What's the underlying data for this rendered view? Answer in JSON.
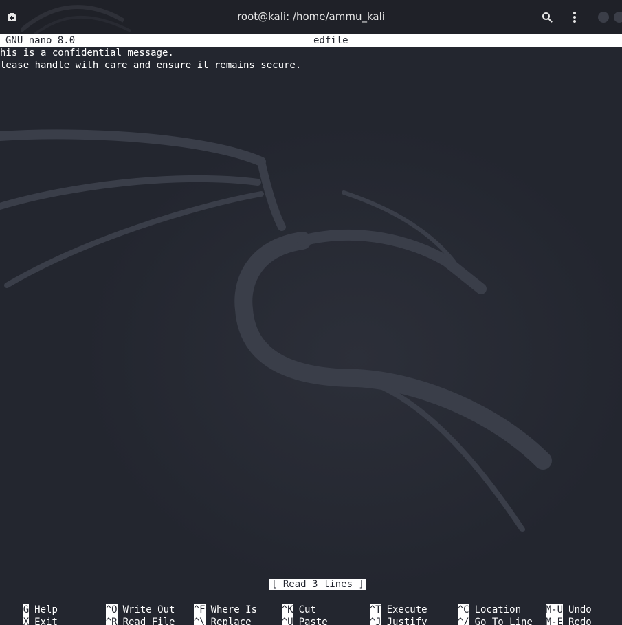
{
  "window": {
    "title": "root@kali: /home/ammu_kali"
  },
  "nano": {
    "version": "GNU nano 8.0",
    "filename": "edfile",
    "lines": [
      "his is a confidential message.",
      "lease handle with care and ensure it remains secure."
    ],
    "status": "[ Read 3 lines ]"
  },
  "shortcuts": [
    {
      "key": "G",
      "label": "Help"
    },
    {
      "key": "^O",
      "label": "Write Out"
    },
    {
      "key": "^F",
      "label": "Where Is"
    },
    {
      "key": "^K",
      "label": "Cut"
    },
    {
      "key": "^T",
      "label": "Execute"
    },
    {
      "key": "^C",
      "label": "Location"
    },
    {
      "key": "M-U",
      "label": "Undo"
    },
    {
      "key": "X",
      "label": "Exit"
    },
    {
      "key": "^R",
      "label": "Read File"
    },
    {
      "key": "^\\",
      "label": "Replace"
    },
    {
      "key": "^U",
      "label": "Paste"
    },
    {
      "key": "^J",
      "label": "Justify"
    },
    {
      "key": "^/",
      "label": "Go To Line"
    },
    {
      "key": "M-E",
      "label": "Redo"
    }
  ],
  "colors": {
    "background": "#23262f",
    "titlebar": "#1f2128",
    "text": "#ffffff",
    "highlight": "#ffffff"
  },
  "icons": {
    "new_tab": "new-tab-icon",
    "search": "search-icon",
    "menu": "kebab-menu-icon",
    "wallpaper": "kali-dragon-icon"
  }
}
